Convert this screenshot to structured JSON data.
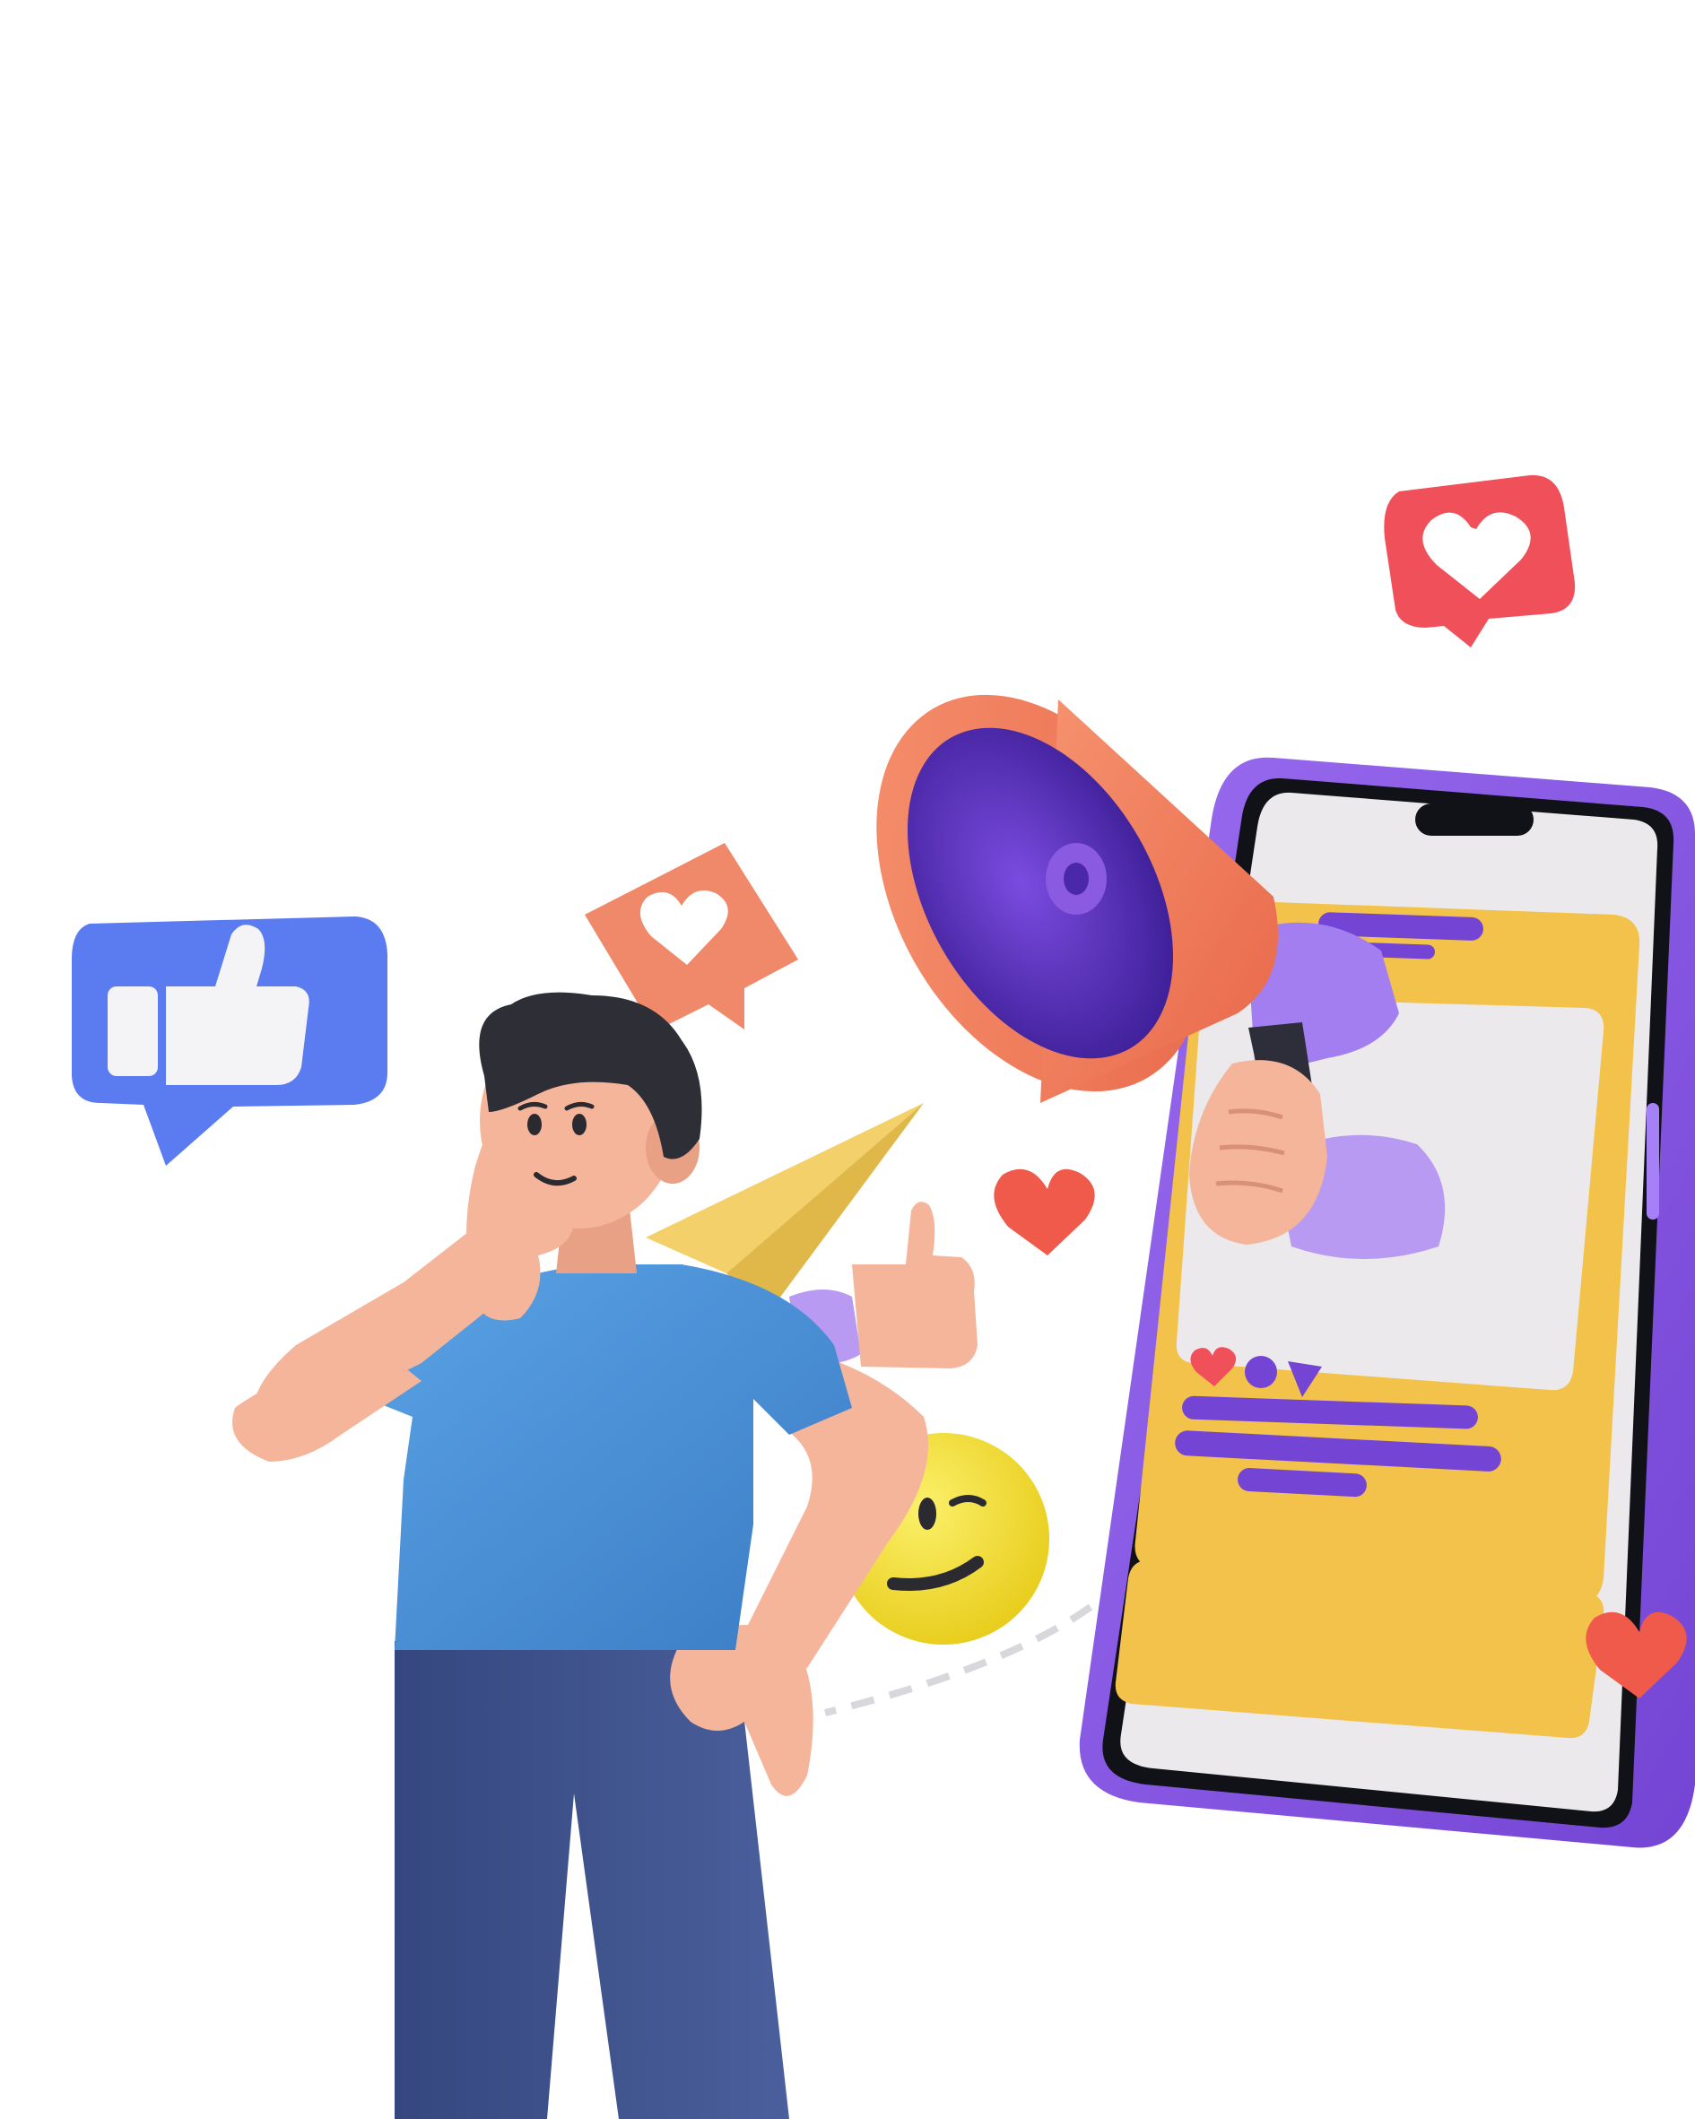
{
  "scene": {
    "subject": "man-with-phone-and-megaphone",
    "colors": {
      "background": "#ffffff",
      "like_badge": "#5b7cf0",
      "heart_badge_red": "#f0505a",
      "heart_badge_salmon": "#f0886a",
      "megaphone": "#f07a5a",
      "megaphone_inner": "#5a2fc0",
      "phone_frame": "#8a5ae0",
      "phone_card": "#f3c24a",
      "shirt": "#4a90d8",
      "pants": "#3a4f8a",
      "skin": "#f5b59a",
      "emoji": "#f7e23a"
    },
    "icons": [
      "thumbs-up-icon",
      "heart-icon",
      "megaphone-icon",
      "paper-plane-icon",
      "smiley-icon",
      "smartphone-icon"
    ]
  }
}
